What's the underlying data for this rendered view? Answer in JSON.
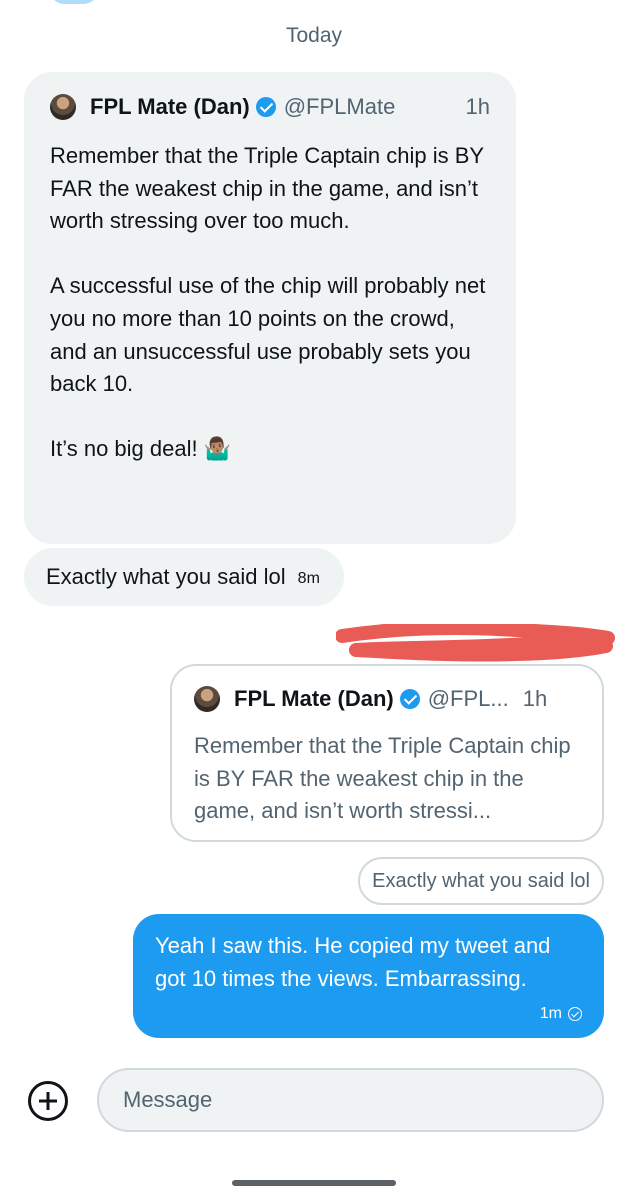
{
  "conversation": {
    "date_separator": "Today"
  },
  "incoming": {
    "quoted_tweet": {
      "author_name": "FPL Mate (Dan)",
      "handle": "@FPLMate",
      "time": "1h",
      "paragraphs": [
        "Remember that the Triple Captain chip is BY FAR the weakest chip in the game, and isn’t worth stressing over too much.",
        "A successful use of the chip will probably net you no more than 10 points on the crowd, and an unsuccessful use probably sets you back 10."
      ],
      "closing_text": "It’s no big deal!",
      "closing_emoji": "🤷🏽‍♂️",
      "verified": true
    },
    "reply": {
      "text": "Exactly what you said lol",
      "time": "8m"
    }
  },
  "outgoing": {
    "quoted_tweet": {
      "author_name": "FPL Mate (Dan)",
      "handle": "@FPL...",
      "time": "1h",
      "text": "Remember that the Triple Captain chip is BY FAR the weakest chip in the game, and isn’t worth stressi...",
      "verified": true
    },
    "reply_reference": "Exactly what you said lol",
    "message": {
      "text": "Yeah I saw this. He copied my tweet and got 10 times the views. Embarrassing.",
      "time": "1m",
      "status_icon": "sent-check-icon"
    }
  },
  "composer": {
    "placeholder": "Message",
    "add_icon": "plus-circle-icon"
  },
  "colors": {
    "accent": "#1d9bf0",
    "incoming_bubble": "#eff3f4",
    "redaction": "#e85c55",
    "secondary_text": "#536471"
  }
}
